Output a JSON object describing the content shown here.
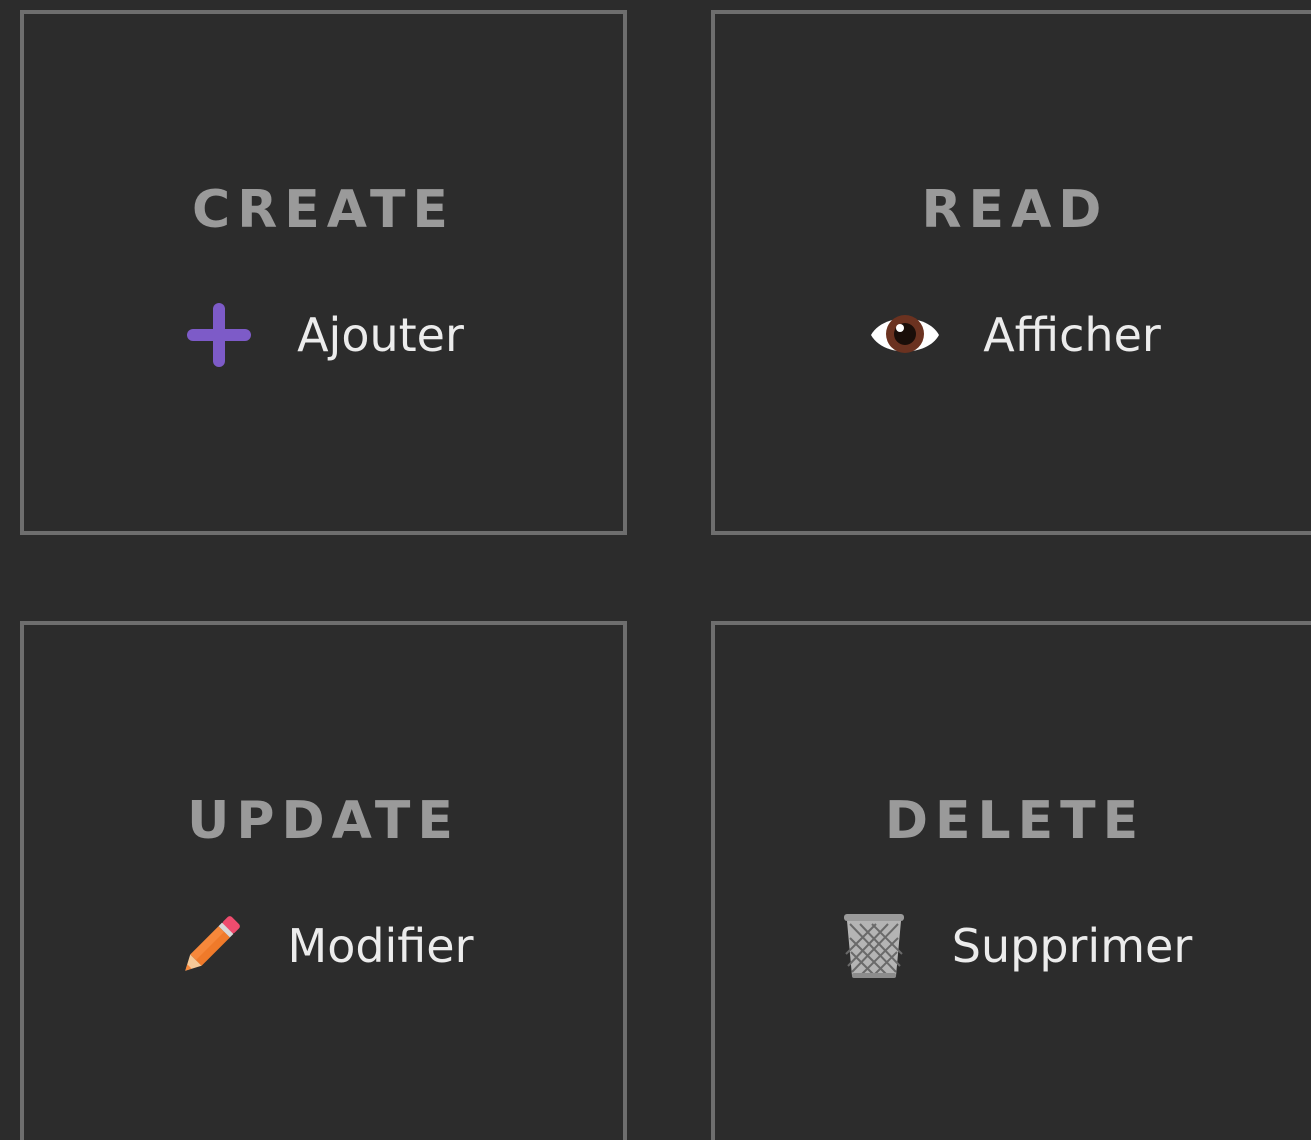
{
  "cards": {
    "create": {
      "title": "CREATE",
      "action_label": "Ajouter",
      "icon": "plus-icon"
    },
    "read": {
      "title": "READ",
      "action_label": "Afficher",
      "icon": "eye-icon"
    },
    "update": {
      "title": "UPDATE",
      "action_label": "Modifier",
      "icon": "pencil-icon"
    },
    "delete": {
      "title": "DELETE",
      "action_label": "Supprimer",
      "icon": "wastebasket-icon"
    }
  },
  "colors": {
    "background": "#2c2c2c",
    "border": "#6e6e6e",
    "title": "#9a9a9a",
    "label": "#ececec",
    "plus": "#7d5bc8",
    "pencil": "#f7883b",
    "eraser": "#ef4c6e"
  }
}
